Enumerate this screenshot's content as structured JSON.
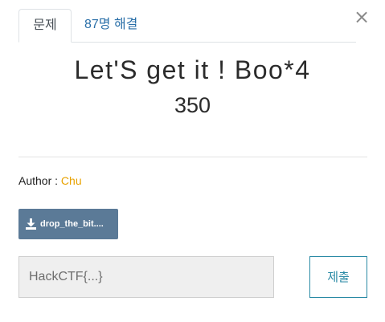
{
  "modal": {
    "close_label": "×"
  },
  "tabs": [
    {
      "label": "문제",
      "active": true
    },
    {
      "label": "87명 해결",
      "active": false
    }
  ],
  "challenge": {
    "title": "Let'S get it ! Boo*4",
    "points": "350"
  },
  "author": {
    "label": "Author : ",
    "name": "Chu"
  },
  "file": {
    "label": "drop_the_bit....",
    "icon": "download-icon"
  },
  "flag": {
    "placeholder": "HackCTF{...}",
    "value": ""
  },
  "submit": {
    "label": "제출"
  },
  "colors": {
    "tab_link": "#2a6fa8",
    "author_name": "#e8a200",
    "file_button": "#5b7a97",
    "submit_border": "#2a8aa5"
  }
}
